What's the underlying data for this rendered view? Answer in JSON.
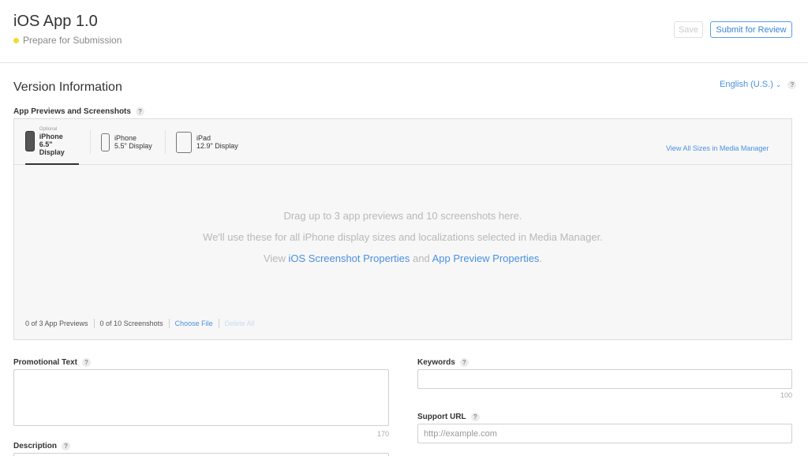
{
  "header": {
    "app_title": "iOS App 1.0",
    "status_text": "Prepare for Submission",
    "status_color": "#f2dc2f",
    "save_label": "Save",
    "submit_label": "Submit for Review"
  },
  "version_info": {
    "title": "Version Information",
    "language": "English (U.S.)",
    "help": "?"
  },
  "media": {
    "label": "App Previews and Screenshots",
    "tabs": [
      {
        "optional": "Optional",
        "line1": "iPhone",
        "line2": "6.5\" Display",
        "icon": "iphone-65-icon"
      },
      {
        "line1": "iPhone",
        "line2": "5.5\" Display",
        "icon": "iphone-55-icon"
      },
      {
        "line1": "iPad",
        "line2": "12.9\" Display",
        "icon": "ipad-icon"
      }
    ],
    "view_all": "View All Sizes in Media Manager",
    "drop_line1": "Drag up to 3 app previews and 10 screenshots here.",
    "drop_line2": "We'll use these for all iPhone display sizes and localizations selected in Media Manager.",
    "drop_line3_prefix": "View ",
    "drop_link1": "iOS Screenshot Properties",
    "drop_line3_and": " and ",
    "drop_link2": "App Preview Properties",
    "drop_line3_suffix": ".",
    "app_previews_count": "0 of 3 App Previews",
    "screenshots_count": "0 of 10 Screenshots",
    "choose_file": "Choose File",
    "delete_all": "Delete All"
  },
  "promotional_text": {
    "label": "Promotional Text",
    "value": "",
    "counter": "170"
  },
  "description": {
    "label": "Description"
  },
  "keywords": {
    "label": "Keywords",
    "value": "",
    "counter": "100"
  },
  "support_url": {
    "label": "Support URL",
    "placeholder": "http://example.com"
  },
  "colors": {
    "accent": "#4a90e2",
    "submit_border": "#5a9ee6"
  }
}
